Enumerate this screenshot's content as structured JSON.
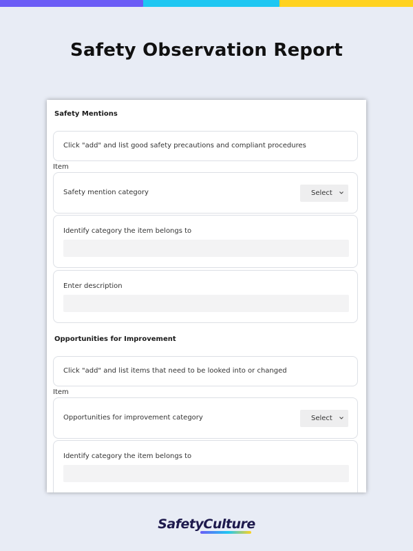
{
  "page": {
    "title": "Safety Observation Report"
  },
  "colors": {
    "bar_purple": "#6b5cf6",
    "bar_cyan": "#1ec7f2",
    "bar_yellow": "#ffd21f",
    "background": "#e8ecf5"
  },
  "sections": [
    {
      "title": "Safety Mentions",
      "instruction": "Click \"add\" and list good safety precautions and compliant procedures",
      "item_label": "Item",
      "category_label": "Safety mention category",
      "select_label": "Select",
      "identify_label": "Identify category the item belongs to",
      "description_label": "Enter description"
    },
    {
      "title": "Opportunities for Improvement",
      "instruction": "Click \"add\" and list items that need to be looked into or changed",
      "item_label": "Item",
      "category_label": "Opportunities for improvement category",
      "select_label": "Select",
      "identify_label": "Identify category the item belongs to"
    }
  ],
  "logo": {
    "text": "SafetyCulture"
  }
}
